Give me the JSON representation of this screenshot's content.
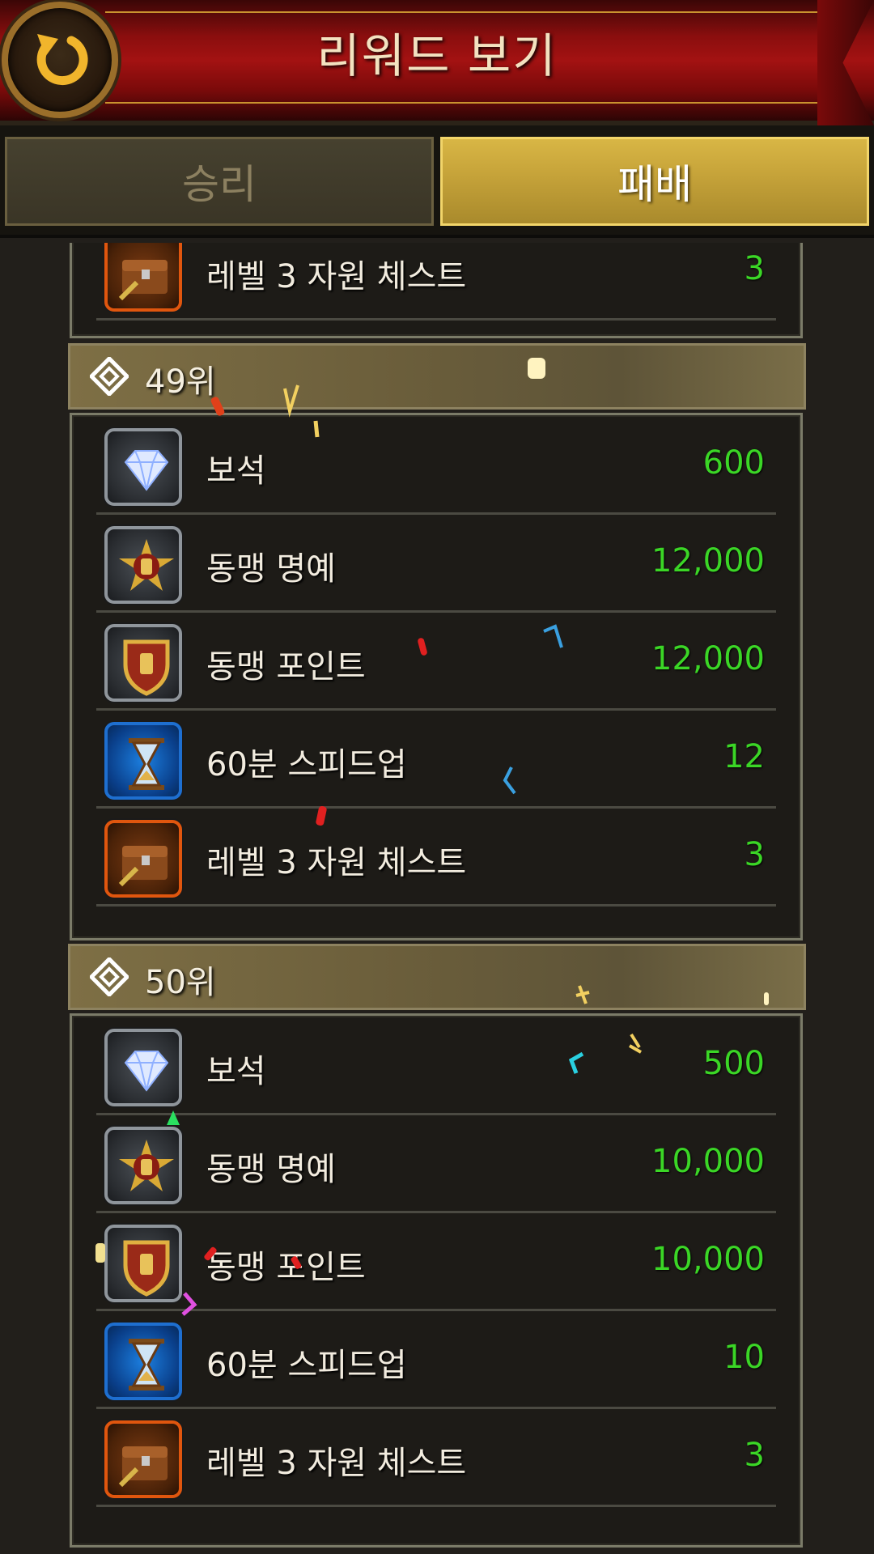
{
  "header": {
    "title": "리워드 보기"
  },
  "tabs": [
    {
      "label": "승리",
      "active": false
    },
    {
      "label": "패배",
      "active": true
    }
  ],
  "colors": {
    "quantity": "#3bd626",
    "tab_active": "#c7a43a",
    "header_red": "#a31212"
  },
  "partial_row": {
    "name": "레벨 3 자원 체스트",
    "qty": "3",
    "icon": "resource-chest-icon"
  },
  "ranks": [
    {
      "label": "49위",
      "rewards": [
        {
          "name": "보석",
          "qty": "600",
          "icon": "gem-icon"
        },
        {
          "name": "동맹 명예",
          "qty": "12,000",
          "icon": "alliance-honor-icon"
        },
        {
          "name": "동맹 포인트",
          "qty": "12,000",
          "icon": "alliance-points-icon"
        },
        {
          "name": "60분 스피드업",
          "qty": "12",
          "icon": "hourglass-icon"
        },
        {
          "name": "레벨 3 자원 체스트",
          "qty": "3",
          "icon": "resource-chest-icon"
        }
      ]
    },
    {
      "label": "50위",
      "rewards": [
        {
          "name": "보석",
          "qty": "500",
          "icon": "gem-icon"
        },
        {
          "name": "동맹 명예",
          "qty": "10,000",
          "icon": "alliance-honor-icon"
        },
        {
          "name": "동맹 포인트",
          "qty": "10,000",
          "icon": "alliance-points-icon"
        },
        {
          "name": "60분 스피드업",
          "qty": "10",
          "icon": "hourglass-icon"
        },
        {
          "name": "레벨 3 자원 체스트",
          "qty": "3",
          "icon": "resource-chest-icon"
        }
      ]
    }
  ]
}
